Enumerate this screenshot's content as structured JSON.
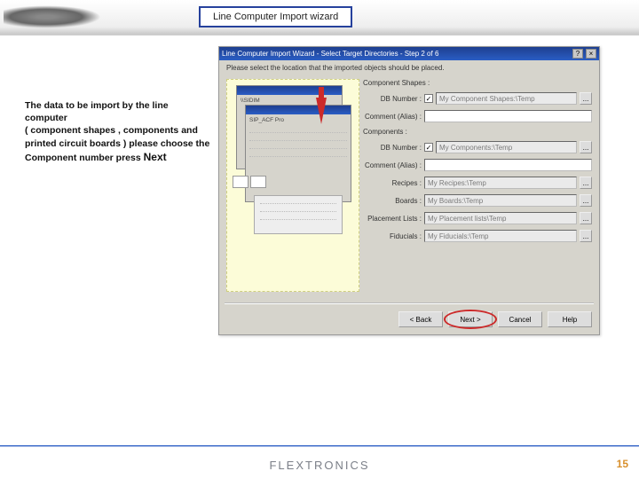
{
  "page": {
    "title_tab": "Line Computer Import wizard",
    "instruction": {
      "l1": "The data to be import by the line computer",
      "l2": "( component shapes , components and",
      "l3": " printed circuit boards ) please choose the",
      "l4_prefix": "Component number press ",
      "l4_next": "Next"
    },
    "footer_brand": "FLEXTRONICS",
    "page_number": "15"
  },
  "wizard": {
    "title": "Line Computer Import Wizard - Select Target Directories - Step 2 of 6",
    "help_q": "?",
    "close_x": "×",
    "header_prompt": "Please select the location that the imported objects should be placed.",
    "preview": {
      "tree_root": "\\\\SIDIM",
      "tree_item": "SIP_ACF Pro"
    },
    "sections": {
      "shapes": "Component Shapes :",
      "components": "Components :"
    },
    "rows": {
      "shapes_db": {
        "label": "DB Number :",
        "checked": true,
        "value": "My Component Shapes:\\Temp"
      },
      "shapes_comment": {
        "label": "Comment (Alias) :",
        "value": ""
      },
      "comp_db": {
        "label": "DB Number :",
        "checked": true,
        "value": "My Components:\\Temp"
      },
      "comp_comment": {
        "label": "Comment (Alias) :",
        "value": ""
      },
      "recipes": {
        "label": "Recipes :",
        "value": "My Recipes:\\Temp"
      },
      "boards": {
        "label": "Boards :",
        "value": "My Boards:\\Temp"
      },
      "placement": {
        "label": "Placement Lists :",
        "value": "My Placement lists\\Temp"
      },
      "fiducials": {
        "label": "Fiducials :",
        "value": "My Fiducials:\\Temp"
      }
    },
    "browse": "...",
    "buttons": {
      "back": "< Back",
      "next": "Next >",
      "cancel": "Cancel",
      "help": "Help"
    }
  }
}
